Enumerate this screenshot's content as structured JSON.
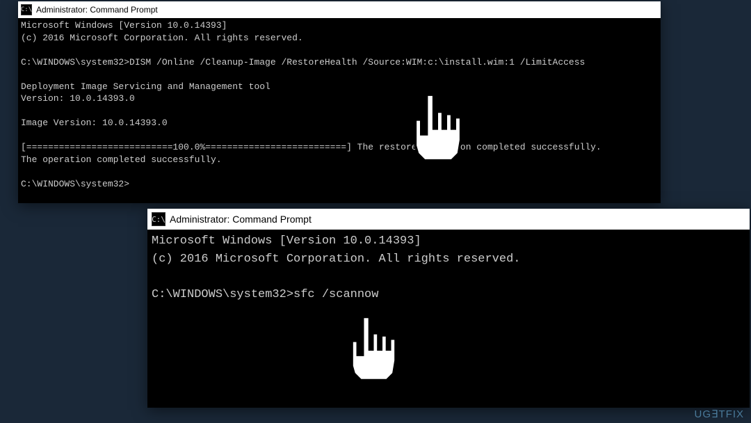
{
  "window1": {
    "title": "Administrator: Command Prompt",
    "lines": [
      "Microsoft Windows [Version 10.0.14393]",
      "(c) 2016 Microsoft Corporation. All rights reserved.",
      "",
      "C:\\WINDOWS\\system32>DISM /Online /Cleanup-Image /RestoreHealth /Source:WIM:c:\\install.wim:1 /LimitAccess",
      "",
      "Deployment Image Servicing and Management tool",
      "Version: 10.0.14393.0",
      "",
      "Image Version: 10.0.14393.0",
      "",
      "[===========================100.0%==========================] The restore operation completed successfully.",
      "The operation completed successfully.",
      "",
      "C:\\WINDOWS\\system32>"
    ]
  },
  "window2": {
    "title": "Administrator: Command Prompt",
    "lines": [
      "Microsoft Windows [Version 10.0.14393]",
      "(c) 2016 Microsoft Corporation. All rights reserved.",
      "",
      "C:\\WINDOWS\\system32>sfc /scannow"
    ]
  },
  "watermark": "UG∃TFIX"
}
